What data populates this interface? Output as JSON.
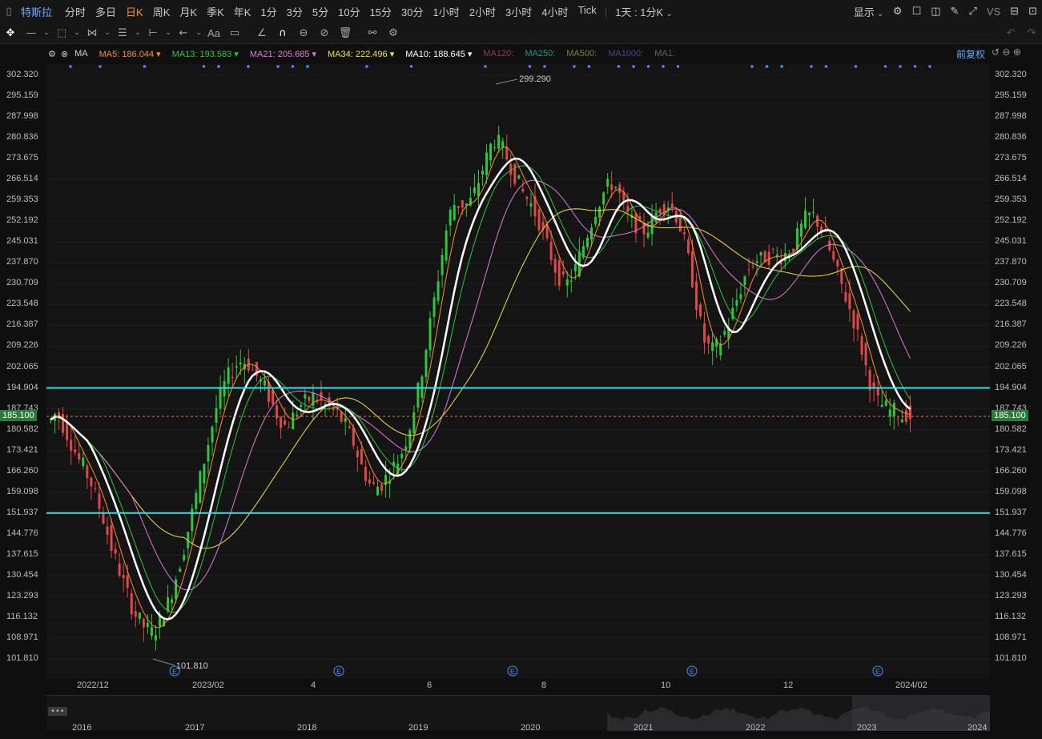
{
  "topbar": {
    "symbol": "特斯拉",
    "timeframes": [
      "分时",
      "多日",
      "日K",
      "周K",
      "月K",
      "季K",
      "年K",
      "1分",
      "3分",
      "5分",
      "10分",
      "15分",
      "30分",
      "1小时",
      "2小时",
      "3小时",
      "4小时",
      "Tick"
    ],
    "active_timeframe": "日K",
    "interval_label": "1天 : 1分K",
    "display_label": "显示",
    "vs_label": "VS"
  },
  "ma_legend": [
    {
      "label": "MA",
      "value": "",
      "color": "#d0d0d0"
    },
    {
      "label": "MA5:",
      "value": "186.044",
      "color": "#ff8c2a"
    },
    {
      "label": "MA13:",
      "value": "193.583",
      "color": "#2cc83a"
    },
    {
      "label": "MA21:",
      "value": "205.685",
      "color": "#e07ad8"
    },
    {
      "label": "MA34:",
      "value": "222.496",
      "color": "#f2e33a"
    },
    {
      "label": "MA10:",
      "value": "188.645",
      "color": "#ffffff"
    },
    {
      "label": "MA120:",
      "value": "",
      "color": "#9c3b3b"
    },
    {
      "label": "MA250:",
      "value": "",
      "color": "#2c8f8f"
    },
    {
      "label": "MA500:",
      "value": "",
      "color": "#8a7a2a"
    },
    {
      "label": "MA1000:",
      "value": "",
      "color": "#5a3f8a"
    },
    {
      "label": "MA1:",
      "value": "",
      "color": "#606060"
    }
  ],
  "adjust_label": "前复权",
  "price_axis": [
    "302.320",
    "295.159",
    "287.998",
    "280.836",
    "273.675",
    "266.514",
    "259.353",
    "252.192",
    "245.031",
    "237.870",
    "230.709",
    "223.548",
    "216.387",
    "209.226",
    "202.065",
    "194.904",
    "187.743",
    "180.582",
    "173.421",
    "166.260",
    "159.098",
    "151.937",
    "144.776",
    "137.615",
    "130.454",
    "123.293",
    "116.132",
    "108.971",
    "101.810"
  ],
  "current_price": "185.100",
  "high_label": "299.290",
  "low_label": "101.810",
  "x_axis_labels": [
    "2022/12",
    "2023/02",
    "4",
    "6",
    "8",
    "10",
    "12",
    "2024/02"
  ],
  "nav_years": [
    "2016",
    "2017",
    "2018",
    "2019",
    "2020",
    "2021",
    "2022",
    "2023",
    "2024"
  ],
  "earnings_marker": "E",
  "colors": {
    "up": "#2cc83a",
    "down": "#e04848",
    "hline": "#33e0e8"
  },
  "chart_data": {
    "type": "candlestick",
    "ylim": [
      101.81,
      302.32
    ],
    "horizontal_lines": [
      194.904,
      151.937
    ],
    "current_price_line": 185.1,
    "close_series": [
      184,
      186,
      185,
      182,
      179,
      176,
      173,
      170,
      168,
      165,
      162,
      158,
      154,
      150,
      145,
      140,
      136,
      132,
      128,
      124,
      120,
      117,
      115,
      113,
      112,
      111,
      112,
      115,
      118,
      121,
      125,
      130,
      135,
      140,
      146,
      152,
      158,
      164,
      170,
      176,
      182,
      188,
      192,
      196,
      199,
      201,
      203,
      204,
      204,
      203,
      201,
      199,
      197,
      195,
      192,
      189,
      186,
      184,
      182,
      183,
      185,
      187,
      189,
      190,
      191,
      192,
      191,
      190,
      189,
      188,
      187,
      186,
      184,
      182,
      179,
      176,
      172,
      168,
      165,
      162,
      161,
      161,
      162,
      164,
      166,
      168,
      170,
      173,
      177,
      182,
      188,
      194,
      201,
      209,
      217,
      225,
      233,
      241,
      249,
      255,
      258,
      258,
      258,
      258,
      259,
      262,
      266,
      270,
      274,
      278,
      280,
      279,
      277,
      274,
      271,
      268,
      265,
      262,
      260,
      258,
      255,
      252,
      248,
      244,
      240,
      236,
      233,
      231,
      231,
      233,
      236,
      240,
      244,
      248,
      252,
      256,
      259,
      262,
      264,
      265,
      264,
      261,
      257,
      254,
      252,
      251,
      250,
      249,
      250,
      252,
      255,
      257,
      258,
      258,
      257,
      254,
      250,
      245,
      239,
      232,
      224,
      217,
      211,
      209,
      208,
      209,
      211,
      214,
      217,
      221,
      225,
      229,
      233,
      236,
      238,
      239,
      239,
      240,
      240,
      241,
      240,
      240,
      241,
      242,
      244,
      247,
      250,
      253,
      254,
      254,
      252,
      249,
      246,
      242,
      238,
      234,
      230,
      226,
      222,
      218,
      213,
      208,
      202,
      197,
      193,
      190,
      189,
      188,
      187,
      187,
      186,
      185,
      186,
      185
    ]
  }
}
